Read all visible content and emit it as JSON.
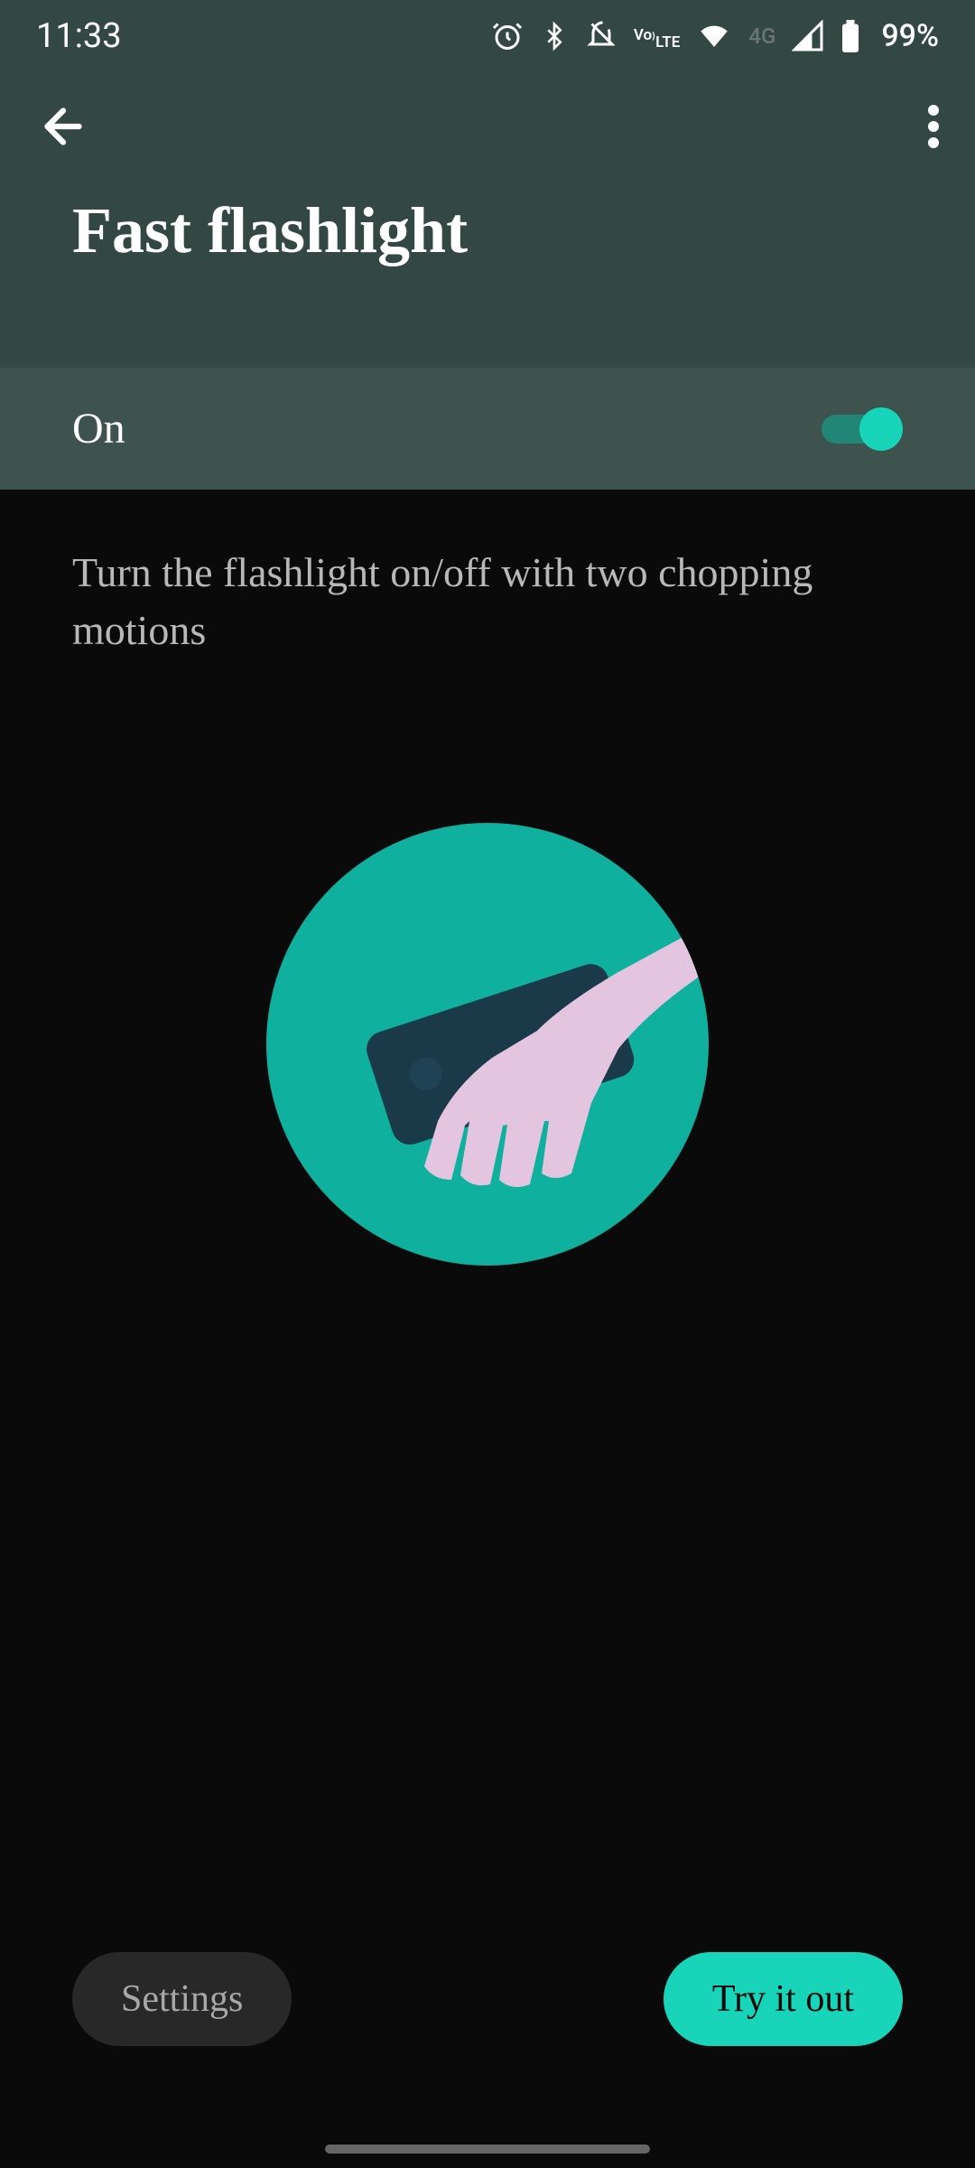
{
  "status": {
    "time": "11:33",
    "network_label": "4G",
    "battery": "99%",
    "volte": "Vo\nLTE"
  },
  "header": {
    "title": "Fast flashlight"
  },
  "toggle": {
    "label": "On",
    "enabled": true
  },
  "content": {
    "description": "Turn the flashlight on/off with two chopping motions"
  },
  "buttons": {
    "settings": "Settings",
    "try": "Try it out"
  }
}
